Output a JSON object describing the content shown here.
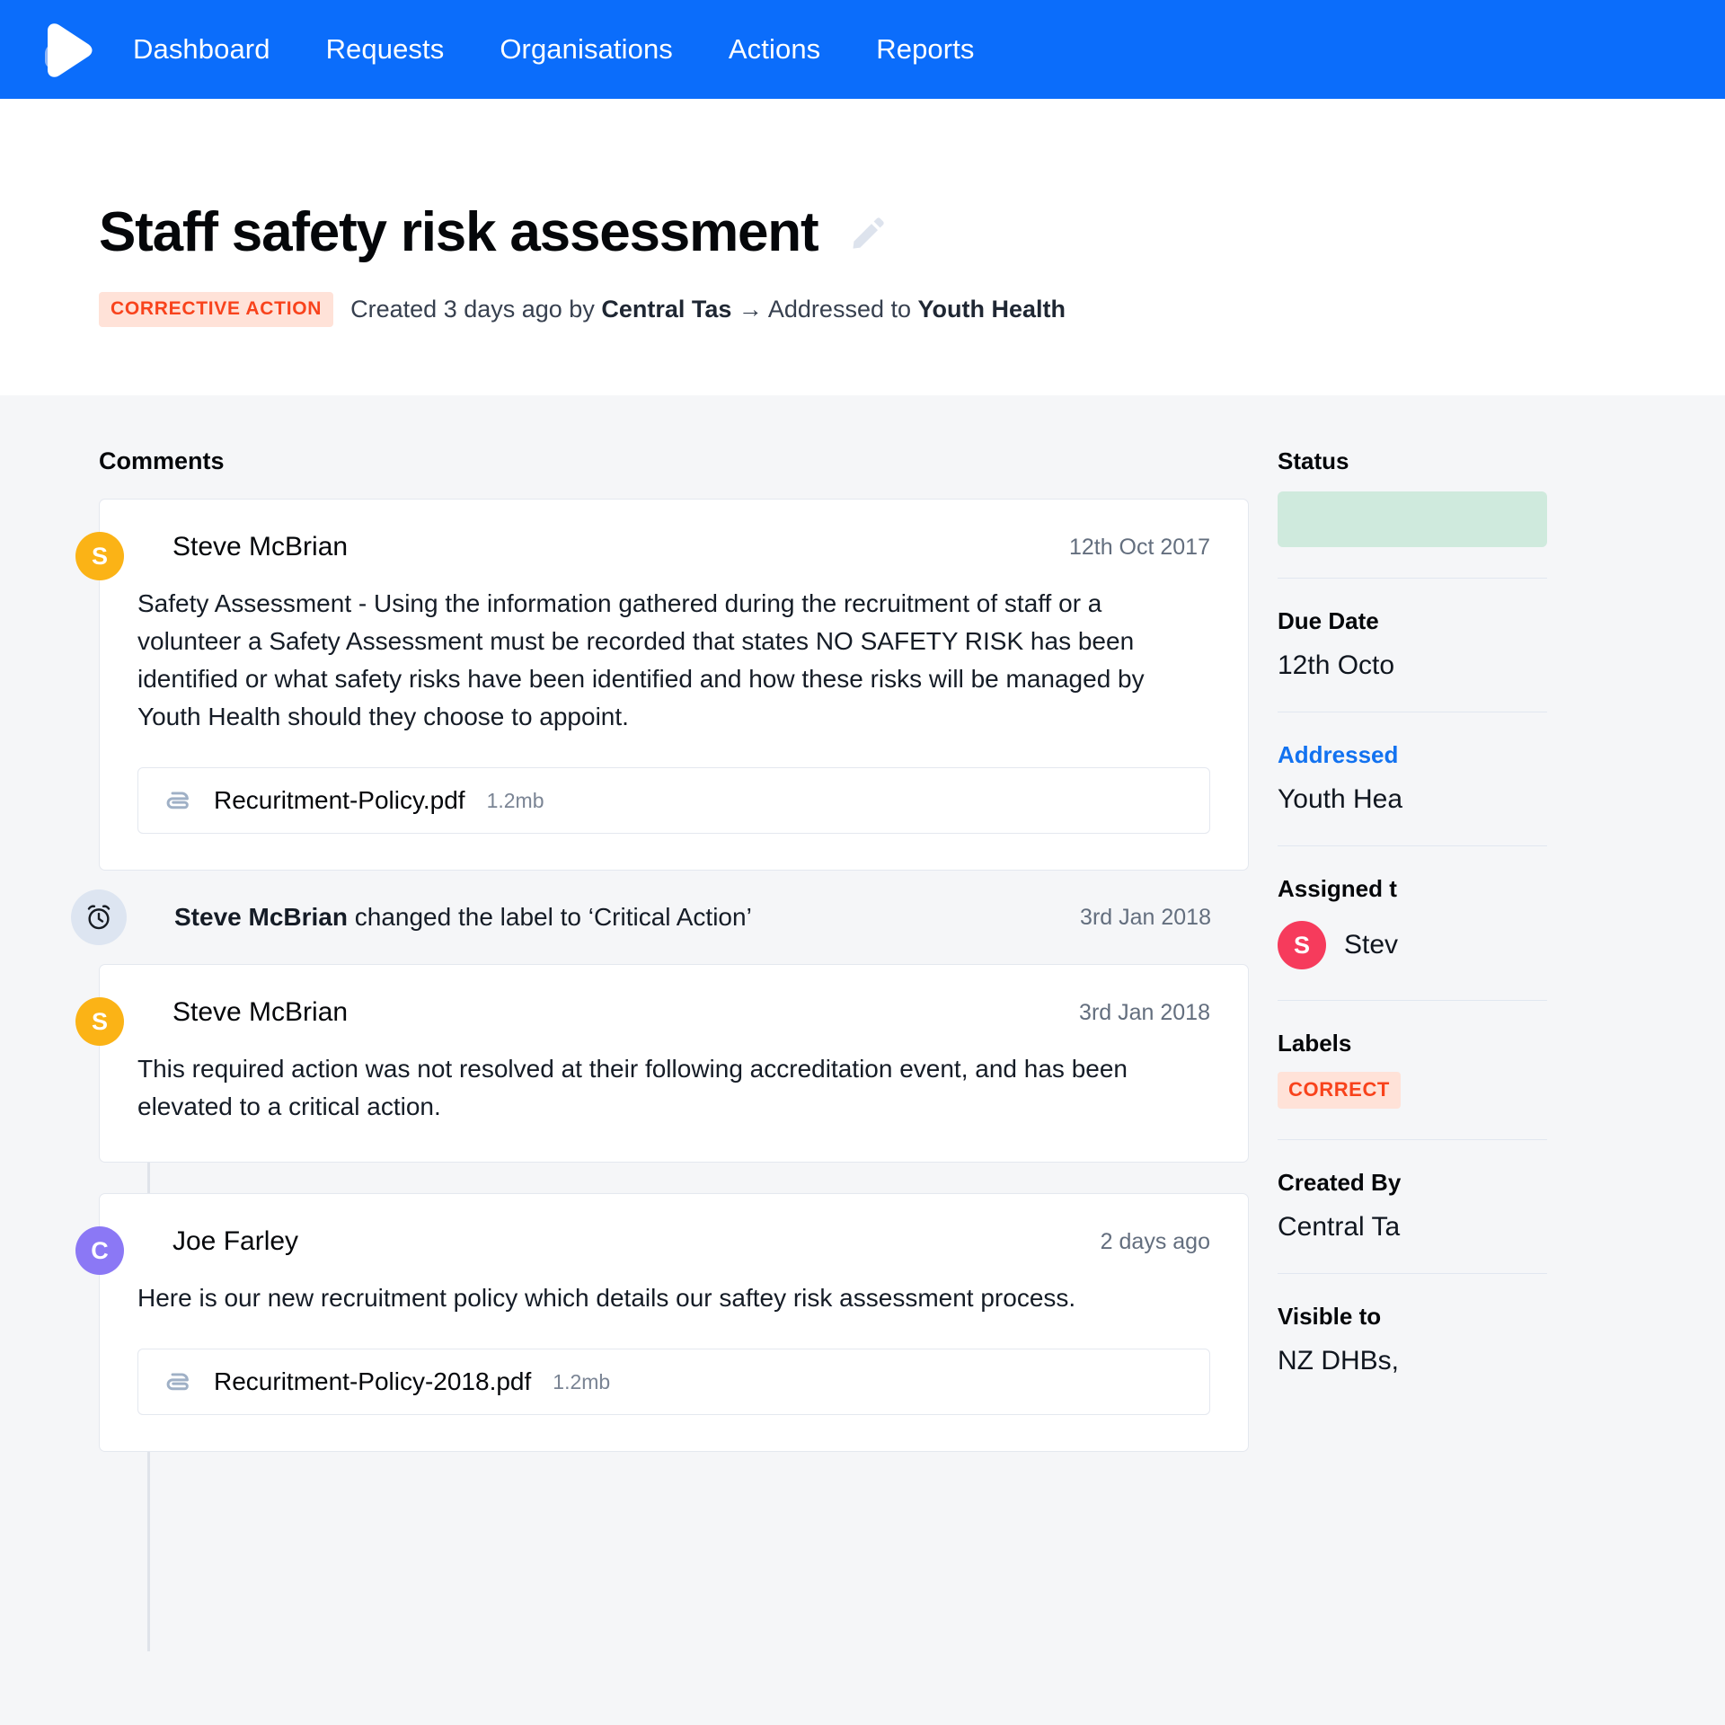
{
  "nav": {
    "logo_name": "play-logo",
    "links": [
      {
        "label": "Dashboard"
      },
      {
        "label": "Requests"
      },
      {
        "label": "Organisations"
      },
      {
        "label": "Actions"
      },
      {
        "label": "Reports"
      }
    ],
    "background_color": "#0b6dfb"
  },
  "header": {
    "title": "Staff safety risk assessment",
    "edit_icon": "pencil-icon",
    "badge": "CORRECTIVE ACTION",
    "badge_color": "#f8431c",
    "badge_bg": "#ffe2d8",
    "meta_created": "Created 3 days ago by ",
    "meta_creator": "Central Tas",
    "meta_arrow": " → ",
    "meta_addressed": "Addressed to ",
    "meta_org": "Youth Health"
  },
  "main": {
    "section_label": "Comments",
    "feed": [
      {
        "type": "comment",
        "avatar_letter": "S",
        "avatar_color": "#fbb316",
        "author": "Steve McBrian",
        "date": "12th Oct 2017",
        "body": "Safety Assessment - Using the information gathered during the recruitment of staff or a volunteer a Safety Assessment must be recorded that states NO SAFETY RISK has been identified or what safety risks have been identified and how these risks will be managed by Youth Health should they choose to appoint.",
        "attachment": {
          "icon": "paperclip-icon",
          "name": "Recuritment-Policy.pdf",
          "size": "1.2mb"
        }
      },
      {
        "type": "activity",
        "icon": "alarm-clock-icon",
        "actor": "Steve McBrian",
        "text": " changed the label to ‘Critical Action’",
        "date": "3rd Jan 2018"
      },
      {
        "type": "comment",
        "avatar_letter": "S",
        "avatar_color": "#fbb316",
        "author": "Steve McBrian",
        "date": "3rd Jan 2018",
        "body": "This required action was not resolved at their following accreditation event, and has been elevated to a critical action.",
        "attachment": null
      },
      {
        "type": "comment",
        "avatar_letter": "C",
        "avatar_color": "#8b78f5",
        "author": "Joe Farley",
        "date": "2 days ago",
        "body": "Here is our new recruitment policy which details our saftey risk assessment process.",
        "attachment": {
          "icon": "paperclip-icon",
          "name": "Recuritment-Policy-2018.pdf",
          "size": "1.2mb"
        }
      }
    ]
  },
  "sidebar": {
    "status_label": "Status",
    "status_value": "",
    "status_color": "#cfeadd",
    "due_date_label": "Due Date",
    "due_date_value": "12th Octo",
    "addressed_label": "Addressed",
    "addressed_value": "Youth Hea",
    "assigned_label": "Assigned t",
    "assigned_avatar_letter": "S",
    "assigned_avatar_color": "#f63b5c",
    "assigned_value": "Stev",
    "labels_label": "Labels",
    "labels_badge": "CORRECT",
    "created_by_label": "Created By",
    "created_by_value": "Central Ta",
    "visible_to_label": "Visible to",
    "visible_to_value": "NZ DHBs,"
  }
}
